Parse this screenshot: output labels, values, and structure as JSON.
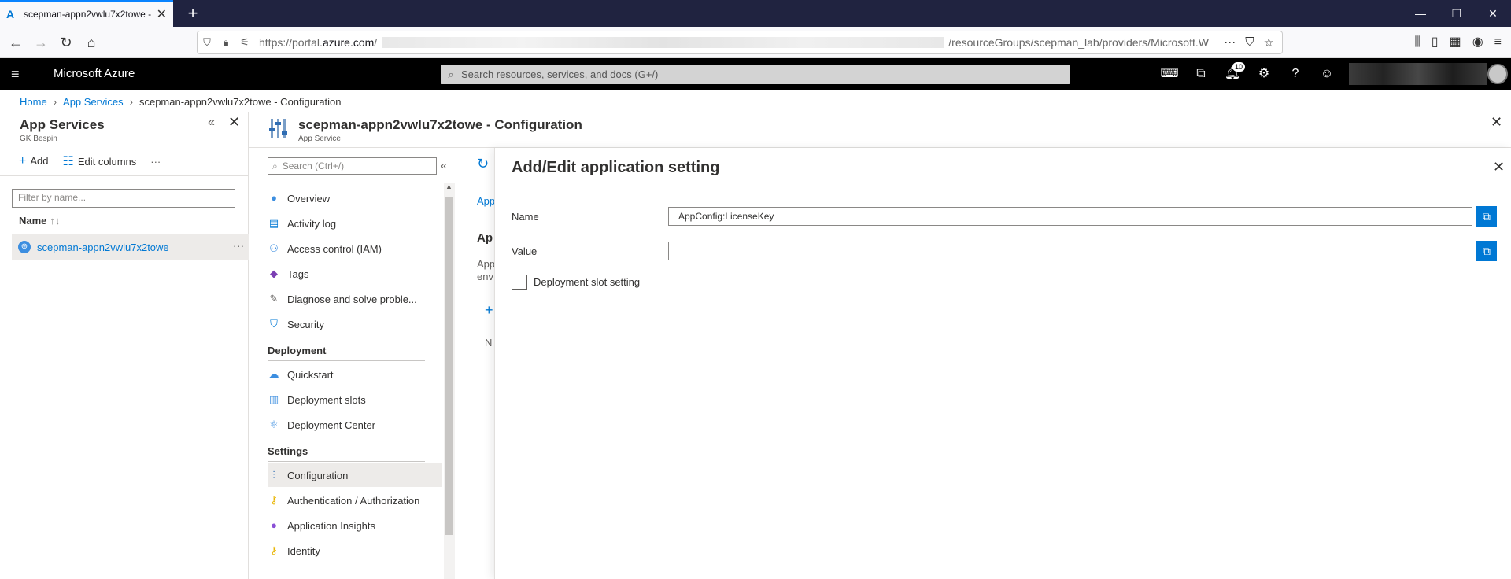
{
  "browser": {
    "tab_title": "scepman-appn2vwlu7x2towe -",
    "url_prefix": "https://portal.",
    "url_domain": "azure.com",
    "url_slash": "/",
    "url_suffix": "/resourceGroups/scepman_lab/providers/Microsoft.W"
  },
  "azure": {
    "brand": "Microsoft Azure",
    "search_placeholder": "Search resources, services, and docs (G+/)",
    "notification_count": "10"
  },
  "breadcrumb": {
    "home": "Home",
    "app_services": "App Services",
    "current": "scepman-appn2vwlu7x2towe - Configuration"
  },
  "left_blade": {
    "title": "App Services",
    "subtitle": "GK Bespin",
    "add_label": "Add",
    "edit_columns_label": "Edit columns",
    "filter_placeholder": "Filter by name...",
    "column_name": "Name",
    "row_name": "scepman-appn2vwlu7x2towe"
  },
  "resource": {
    "title": "scepman-appn2vwlu7x2towe - Configuration",
    "subtitle": "App Service",
    "menu_search_placeholder": "Search (Ctrl+/)",
    "menu": {
      "overview": "Overview",
      "activity_log": "Activity log",
      "access_control": "Access control (IAM)",
      "tags": "Tags",
      "diagnose": "Diagnose and solve proble...",
      "security": "Security",
      "section_deployment": "Deployment",
      "quickstart": "Quickstart",
      "deployment_slots": "Deployment slots",
      "deployment_center": "Deployment Center",
      "section_settings": "Settings",
      "configuration": "Configuration",
      "auth": "Authentication / Authorization",
      "app_insights": "Application Insights",
      "identity": "Identity"
    },
    "content_fragments": {
      "tab": "App",
      "heading": "Ap",
      "desc1": "App",
      "desc2": "env",
      "col": "N"
    }
  },
  "pane": {
    "title": "Add/Edit application setting",
    "name_label": "Name",
    "name_value": "AppConfig:LicenseKey",
    "value_label": "Value",
    "value_value": "",
    "slot_label": "Deployment slot setting"
  }
}
